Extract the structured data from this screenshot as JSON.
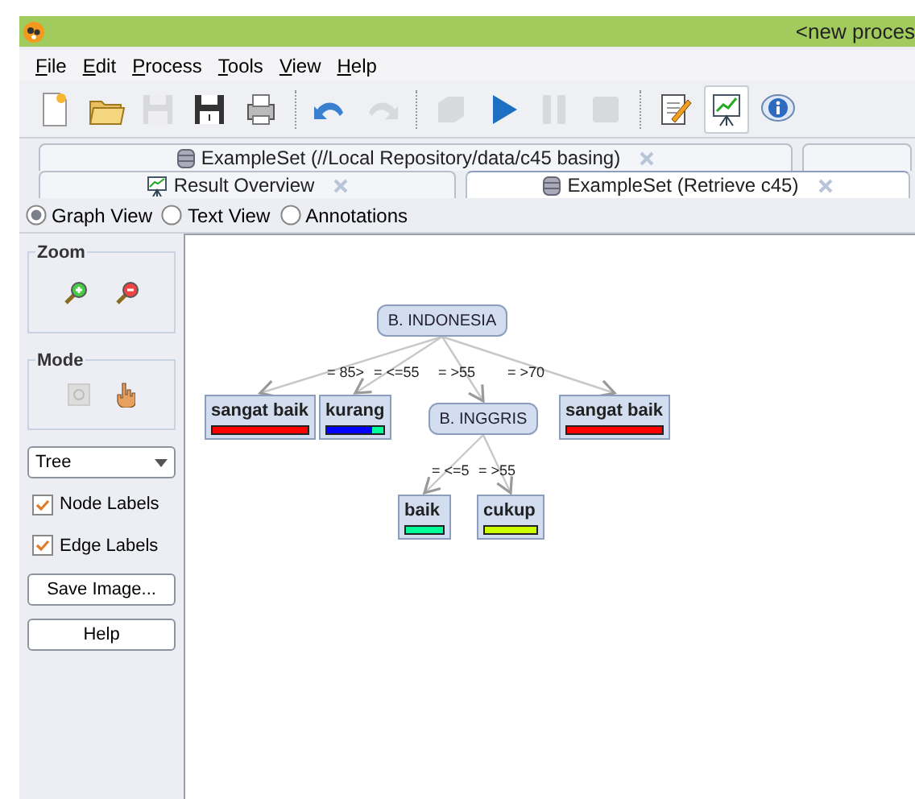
{
  "window": {
    "title": "<new proces"
  },
  "menu": [
    "File",
    "Edit",
    "Process",
    "Tools",
    "View",
    "Help"
  ],
  "toolbar": [
    {
      "kind": "new",
      "disabled": false,
      "selected": false
    },
    {
      "kind": "open",
      "disabled": false,
      "selected": false
    },
    {
      "kind": "save",
      "disabled": true,
      "selected": false
    },
    {
      "kind": "saveas",
      "disabled": false,
      "selected": false
    },
    {
      "kind": "print",
      "disabled": false,
      "selected": false
    },
    {
      "kind": "sep"
    },
    {
      "kind": "undo",
      "disabled": false,
      "selected": false
    },
    {
      "kind": "redo",
      "disabled": true,
      "selected": false
    },
    {
      "kind": "sep"
    },
    {
      "kind": "box",
      "disabled": true,
      "selected": false
    },
    {
      "kind": "run",
      "disabled": false,
      "selected": false
    },
    {
      "kind": "pause",
      "disabled": true,
      "selected": false
    },
    {
      "kind": "stop",
      "disabled": true,
      "selected": false
    },
    {
      "kind": "sep"
    },
    {
      "kind": "notes",
      "disabled": false,
      "selected": false
    },
    {
      "kind": "results",
      "disabled": false,
      "selected": true
    },
    {
      "kind": "info",
      "disabled": false,
      "selected": false
    }
  ],
  "tab_rows": [
    [
      {
        "label": "ExampleSet (//Local Repository/data/c45 basing)",
        "closable": true,
        "selected": false
      },
      {
        "closable": false,
        "selected": false
      }
    ],
    [
      {
        "label": "Result Overview",
        "closable": true,
        "selected": false
      },
      {
        "label": "ExampleSet (Retrieve c45)",
        "closable": true,
        "selected": true
      }
    ]
  ],
  "views": [
    {
      "label": "Graph View",
      "selected": true
    },
    {
      "label": "Text View",
      "selected": false
    },
    {
      "label": "Annotations",
      "selected": false
    }
  ],
  "sidebar": {
    "zoom_title": "Zoom",
    "mode_title": "Mode",
    "layout": "Tree",
    "checkboxes": [
      {
        "label": "Node Labels",
        "checked": true
      },
      {
        "label": "Edge Labels",
        "checked": true
      }
    ],
    "buttons": [
      "Save Image...",
      "Help"
    ]
  },
  "tree": {
    "kind": "split",
    "label": "B. INDONESIA",
    "children": [
      {
        "edge_label": "= 85>",
        "kind": "leaf",
        "label": "sangat baik",
        "segments": [
          {
            "color": "#ff0000",
            "level": 1
          }
        ]
      },
      {
        "edge_label": "= <=55",
        "kind": "leaf",
        "label": "kurang",
        "segments": [
          {
            "color": "#0000ff",
            "level": 0.8
          },
          {
            "color": "#00ff99",
            "level": 0.2
          }
        ]
      },
      {
        "edge_label": "= >55",
        "kind": "split",
        "label": "B. INGGRIS",
        "children": [
          {
            "edge_label": "= <=5",
            "kind": "leaf",
            "label": "baik",
            "segments": [
              {
                "color": "#00ff99",
                "level": 1
              }
            ]
          },
          {
            "edge_label": "= >55",
            "kind": "leaf",
            "label": "cukup",
            "segments": [
              {
                "color": "#ccff00",
                "level": 1
              }
            ]
          }
        ]
      },
      {
        "edge_label": "= >70",
        "kind": "leaf",
        "label": "sangat baik",
        "segments": [
          {
            "color": "#ff0000",
            "level": 1
          }
        ]
      }
    ]
  }
}
